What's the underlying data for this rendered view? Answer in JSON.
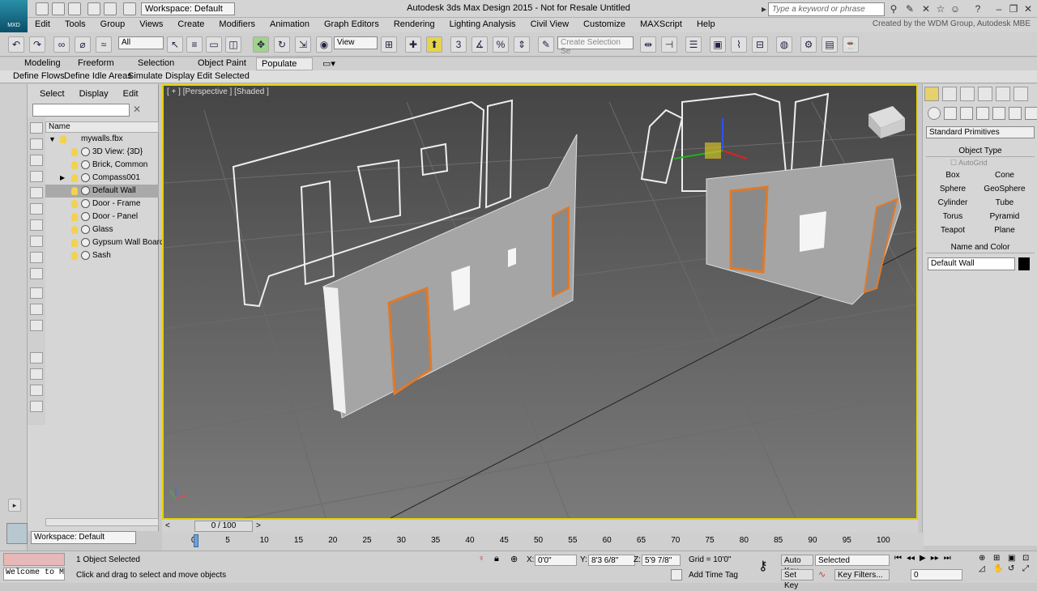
{
  "app": {
    "logo_text": "MXD",
    "title": "Autodesk 3ds Max Design 2015 - Not for Resale  Untitled",
    "workspace": "Workspace: Default",
    "search_placeholder": "Type a keyword or phrase",
    "credit": "Created by the WDM Group, Autodesk MBE"
  },
  "menu": [
    "Edit",
    "Tools",
    "Group",
    "Views",
    "Create",
    "Modifiers",
    "Animation",
    "Graph Editors",
    "Rendering",
    "Lighting Analysis",
    "Civil View",
    "Customize",
    "MAXScript",
    "Help"
  ],
  "toolbar": {
    "selection_filter": "All",
    "ref_coord": "View",
    "snap_num": "3",
    "named_sel_placeholder": "Create Selection Se"
  },
  "ribbon_tabs": [
    "Modeling",
    "Freeform",
    "Selection",
    "Object Paint",
    "Populate"
  ],
  "ribbon_active": "Populate",
  "subribbon": [
    "Define Flows",
    "Define Idle Areas",
    "Simulate",
    "Display",
    "Edit Selected"
  ],
  "scene_explorer": {
    "tabs": [
      "Select",
      "Display",
      "Edit"
    ],
    "column": "Name",
    "root": "mywalls.fbx",
    "items": [
      "3D View: {3D}",
      "Brick, Common",
      "Compass001",
      "Default Wall",
      "Door - Frame",
      "Door - Panel",
      "Glass",
      "Gypsum Wall Board",
      "Sash"
    ],
    "selected": "Default Wall",
    "workspace": "Workspace: Default"
  },
  "viewport": {
    "label": "[ + ] [Perspective ] [Shaded ]"
  },
  "command_panel": {
    "dropdown": "Standard Primitives",
    "object_type_header": "Object Type",
    "autogrid": "AutoGrid",
    "buttons": [
      "Box",
      "Cone",
      "Sphere",
      "GeoSphere",
      "Cylinder",
      "Tube",
      "Torus",
      "Pyramid",
      "Teapot",
      "Plane"
    ],
    "name_color_header": "Name and Color",
    "object_name": "Default Wall",
    "object_color": "#000000"
  },
  "timeline": {
    "frame": "0 / 100",
    "ticks": [
      "0",
      "5",
      "10",
      "15",
      "20",
      "25",
      "30",
      "35",
      "40",
      "45",
      "50",
      "55",
      "60",
      "65",
      "70",
      "75",
      "80",
      "85",
      "90",
      "95",
      "100"
    ]
  },
  "status": {
    "maxscript": "Welcome to M",
    "selected": "1 Object Selected",
    "prompt": "Click and drag to select and move objects",
    "x_label": "X:",
    "x": "0'0\"",
    "y_label": "Y:",
    "y": "8'3 6/8\"",
    "z_label": "Z:",
    "z": "5'9 7/8\"",
    "grid": "Grid = 10'0\"",
    "add_time_tag": "Add Time Tag",
    "auto_key": "Auto Key",
    "set_key": "Set Key",
    "key_mode": "Selected",
    "key_filters": "Key Filters...",
    "frame": "0"
  }
}
